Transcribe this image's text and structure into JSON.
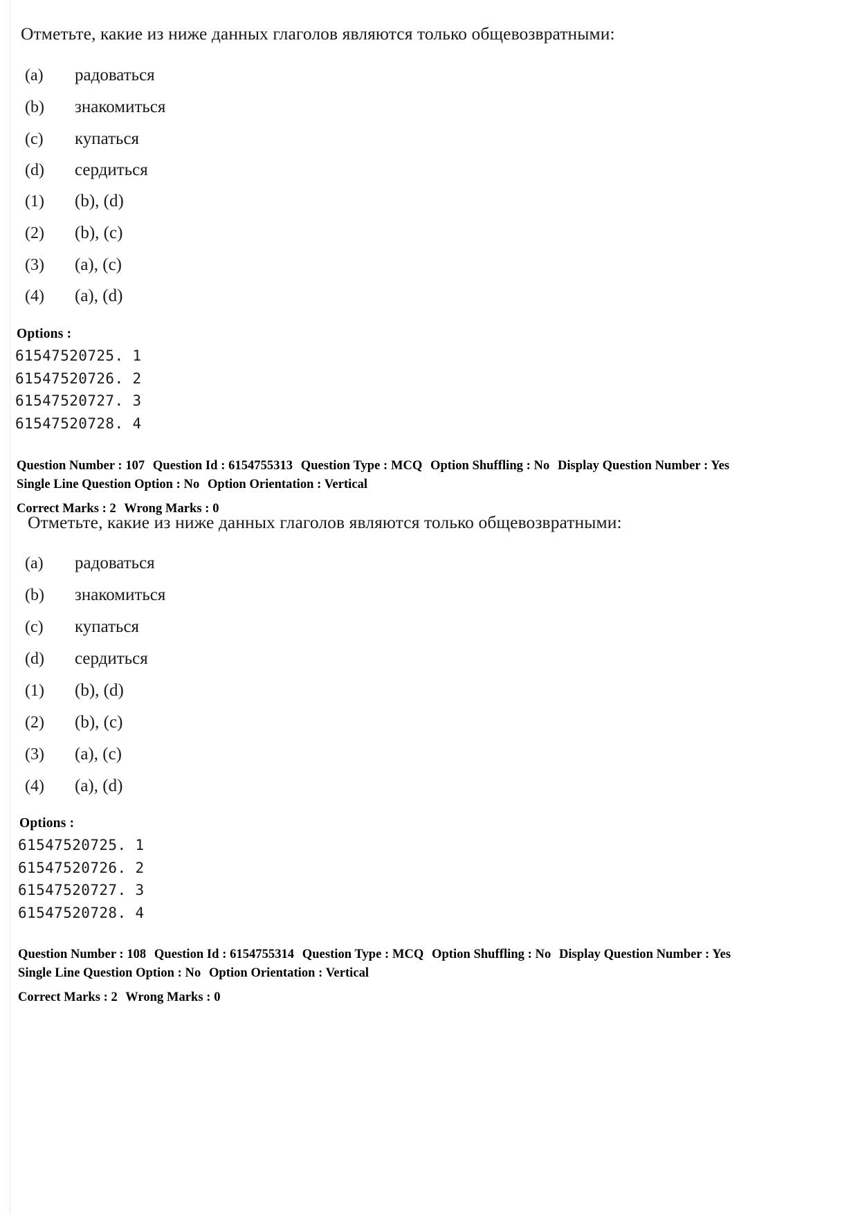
{
  "document": {
    "page_background": "#ffffff",
    "text_color": "#1a1a1a"
  },
  "questions": [
    {
      "stem": "Отметьте, какие из ниже данных глаголов являются только общевозвратными:",
      "items": [
        {
          "key": "(a)",
          "value": "радоваться"
        },
        {
          "key": "(b)",
          "value": "знакомиться"
        },
        {
          "key": "(c)",
          "value": "купаться"
        },
        {
          "key": "(d)",
          "value": "сердиться"
        }
      ],
      "choices": [
        {
          "key": "(1)",
          "value": "(b), (d)"
        },
        {
          "key": "(2)",
          "value": "(b), (c)"
        },
        {
          "key": "(3)",
          "value": "(a), (c)"
        },
        {
          "key": "(4)",
          "value": "(a), (d)"
        }
      ],
      "options_label": "Options :",
      "option_ids": [
        "61547520725. 1",
        "61547520726. 2",
        "61547520727. 3",
        "61547520728. 4"
      ],
      "meta": {
        "question_number_label": "Question Number :",
        "question_number": "107",
        "question_id_label": "Question Id :",
        "question_id": "6154755313",
        "question_type_label": "Question Type :",
        "question_type": "MCQ",
        "option_shuffling_label": "Option Shuffling :",
        "option_shuffling": "No",
        "display_question_number_label": "Display Question Number :",
        "display_question_number": "Yes",
        "single_line_question_option_label": "Single Line Question Option :",
        "single_line_question_option": "No",
        "option_orientation_label": "Option Orientation :",
        "option_orientation": "Vertical",
        "correct_marks_label": "Correct Marks :",
        "correct_marks": "2",
        "wrong_marks_label": "Wrong Marks :",
        "wrong_marks": "0"
      }
    },
    {
      "stem": "Отметьте, какие из ниже данных глаголов являются только общевозвратными:",
      "items": [
        {
          "key": "(a)",
          "value": "радоваться"
        },
        {
          "key": "(b)",
          "value": "знакомиться"
        },
        {
          "key": "(c)",
          "value": "купаться"
        },
        {
          "key": "(d)",
          "value": "сердиться"
        }
      ],
      "choices": [
        {
          "key": "(1)",
          "value": "(b), (d)"
        },
        {
          "key": "(2)",
          "value": "(b), (c)"
        },
        {
          "key": "(3)",
          "value": "(a), (c)"
        },
        {
          "key": "(4)",
          "value": "(a), (d)"
        }
      ],
      "options_label": "Options :",
      "option_ids": [
        "61547520725. 1",
        "61547520726. 2",
        "61547520727. 3",
        "61547520728. 4"
      ],
      "meta": {
        "question_number_label": "Question Number :",
        "question_number": "108",
        "question_id_label": "Question Id :",
        "question_id": "6154755314",
        "question_type_label": "Question Type :",
        "question_type": "MCQ",
        "option_shuffling_label": "Option Shuffling :",
        "option_shuffling": "No",
        "display_question_number_label": "Display Question Number :",
        "display_question_number": "Yes",
        "single_line_question_option_label": "Single Line Question Option :",
        "single_line_question_option": "No",
        "option_orientation_label": "Option Orientation :",
        "option_orientation": "Vertical",
        "correct_marks_label": "Correct Marks :",
        "correct_marks": "2",
        "wrong_marks_label": "Wrong Marks :",
        "wrong_marks": "0"
      }
    }
  ]
}
